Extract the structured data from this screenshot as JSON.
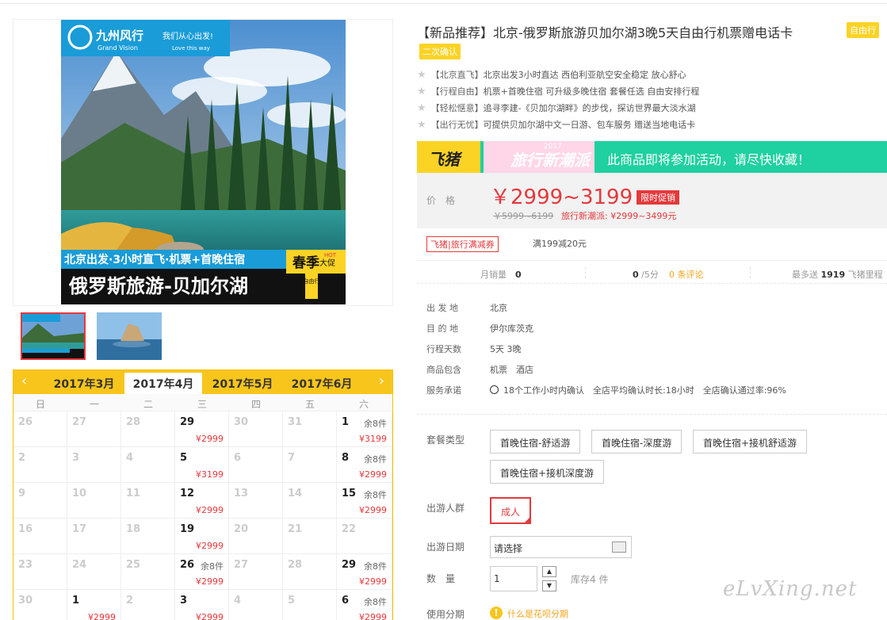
{
  "product": {
    "title": "【新品推荐】北京-俄罗斯旅游贝加尔湖3晚5天自由行机票赠电话卡",
    "tag_free": "自由行",
    "tag_confirm": "二次确认",
    "features": [
      {
        "key": "【北京直飞】",
        "value": "北京出发3小时直达 西伯利亚航空安全稳定 放心舒心"
      },
      {
        "key": "【行程自由】",
        "value": "机票+首晚住宿 可升级多晚住宿 套餐任选 自由安排行程"
      },
      {
        "key": "【轻松惬意】",
        "value": "追寻李建-《贝加尔湖畔》的步伐，探访世界最大淡水湖"
      },
      {
        "key": "【出行无忧】",
        "value": "可提供贝加尔湖中文一日游、包车服务 赠送当地电话卡"
      }
    ]
  },
  "image": {
    "brand_cn": "九州风行",
    "brand_en": "Grand Vision",
    "slogan": "我们从心出发!",
    "slogan_en": "Love this way",
    "caption1": "北京出发·3小时直飞·机票+首晚住宿",
    "caption2": "俄罗斯旅游-贝加尔湖",
    "promo_big": "春季",
    "promo_small": "大促",
    "promo_hot": "HOT",
    "side_tag": "自由行"
  },
  "calendar": {
    "prev": "‹",
    "next": "›",
    "months": [
      "2017年3月",
      "2017年4月",
      "2017年5月",
      "2017年6月"
    ],
    "active_month": 1,
    "weekdays": [
      "日",
      "一",
      "二",
      "三",
      "四",
      "五",
      "六"
    ],
    "rows": [
      [
        {
          "d": "26"
        },
        {
          "d": "27"
        },
        {
          "d": "28"
        },
        {
          "d": "29",
          "p": "¥2999",
          "on": true
        },
        {
          "d": "30"
        },
        {
          "d": "31"
        },
        {
          "d": "1",
          "r": "余8件",
          "p": "¥3199",
          "on": true
        }
      ],
      [
        {
          "d": "2"
        },
        {
          "d": "3"
        },
        {
          "d": "4"
        },
        {
          "d": "5",
          "p": "¥3199",
          "on": true
        },
        {
          "d": "6"
        },
        {
          "d": "7"
        },
        {
          "d": "8",
          "r": "余8件",
          "p": "¥2999",
          "on": true
        }
      ],
      [
        {
          "d": "9"
        },
        {
          "d": "10"
        },
        {
          "d": "11"
        },
        {
          "d": "12",
          "p": "¥2999",
          "on": true
        },
        {
          "d": "13"
        },
        {
          "d": "14"
        },
        {
          "d": "15",
          "r": "余8件",
          "p": "¥2999",
          "on": true
        }
      ],
      [
        {
          "d": "16"
        },
        {
          "d": "17"
        },
        {
          "d": "18"
        },
        {
          "d": "19",
          "p": "¥2999",
          "on": true
        },
        {
          "d": "20"
        },
        {
          "d": "21"
        },
        {
          "d": "22"
        }
      ],
      [
        {
          "d": "23"
        },
        {
          "d": "24"
        },
        {
          "d": "25"
        },
        {
          "d": "26",
          "r": "余8件",
          "p": "¥2999",
          "on": true
        },
        {
          "d": "27"
        },
        {
          "d": "28"
        },
        {
          "d": "29",
          "r": "余8件",
          "p": "¥2999",
          "on": true
        }
      ],
      [
        {
          "d": "30"
        },
        {
          "d": "1",
          "p": "¥2999",
          "on": true
        },
        {
          "d": "2"
        },
        {
          "d": "3",
          "p": "¥2999",
          "on": true
        },
        {
          "d": "4"
        },
        {
          "d": "5"
        },
        {
          "d": "6",
          "r": "余8件",
          "p": "¥2999",
          "on": true
        }
      ]
    ]
  },
  "banner": {
    "brand": "飞猪",
    "activity": "旅行新潮派",
    "year": "2017",
    "text": "此商品即将参加活动，请尽快收藏！"
  },
  "price": {
    "label": "价格",
    "current": "￥2999~3199",
    "promo_tag": "限时促销",
    "original": "￥5999~6199",
    "trend": "旅行新潮派: ¥2999~3499元"
  },
  "coupon": {
    "tag": "飞猪|旅行满减券",
    "text": "满199减20元"
  },
  "stats": {
    "sales_label": "月销量",
    "sales_value": "0",
    "rating_value": "0",
    "rating_suffix": "/5分",
    "reviews": "0 条评论",
    "points_prefix": "最多送",
    "points_value": "1919",
    "points_suffix": "飞猪里程"
  },
  "info": [
    {
      "k": "出 发 地",
      "v": "北京"
    },
    {
      "k": "目 的 地",
      "v": "伊尔库茨克"
    },
    {
      "k": "行程天数",
      "v": "5天 3晚"
    },
    {
      "k": "商品包含",
      "v": "机票　酒店"
    },
    {
      "k": "服务承诺",
      "v": "18个工作小时内确认　全店平均确认时长:18小时　全店确认通过率:96%"
    }
  ],
  "options": {
    "package_label": "套餐类型",
    "packages": [
      "首晚住宿-舒适游",
      "首晚住宿-深度游",
      "首晚住宿+接机舒适游",
      "首晚住宿+接机深度游"
    ],
    "crowd_label": "出游人群",
    "crowd": "成人",
    "date_label": "出游日期",
    "date_value": "请选择",
    "qty_label": "数　量",
    "qty_value": "1",
    "stock": "库存4 件",
    "installment_label": "使用分期",
    "installment_icon": "!",
    "installment_text": "什么是花呗分期"
  },
  "watermark": "eLvXing.net",
  "colors": {
    "accent": "#e4393c",
    "yellow": "#f8c51c",
    "teal": "#1fd0a0"
  }
}
